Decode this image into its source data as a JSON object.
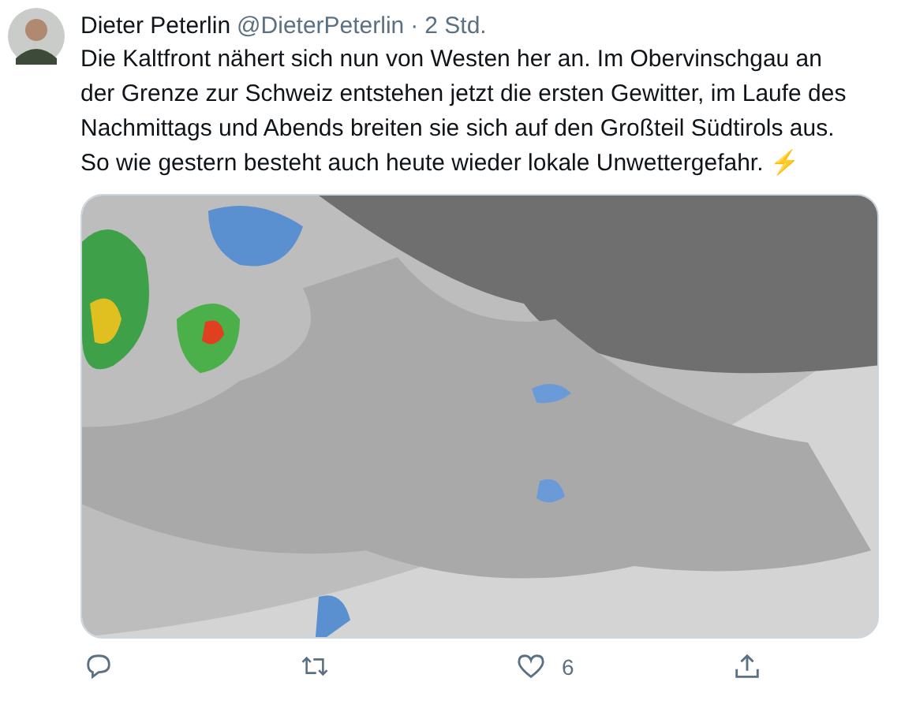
{
  "tweet": {
    "author": {
      "name": "Dieter Peterlin",
      "handle": "@DieterPeterlin",
      "separator": "·",
      "time": "2 Std."
    },
    "text": "Die Kaltfront nähert sich nun von Westen her an. Im Obervinschgau an der Grenze zur Schweiz entstehen jetzt die ersten Gewitter, im Laufe des Nachmittags und Abends breiten sie sich auf den Großteil Südtirols aus. So wie gestern besteht auch heute wieder lokale Unwettergefahr. ⚡",
    "actions": [
      {
        "kind": "reply"
      },
      {
        "kind": "retweet"
      },
      {
        "kind": "like",
        "count": "6"
      },
      {
        "kind": "share"
      }
    ]
  }
}
